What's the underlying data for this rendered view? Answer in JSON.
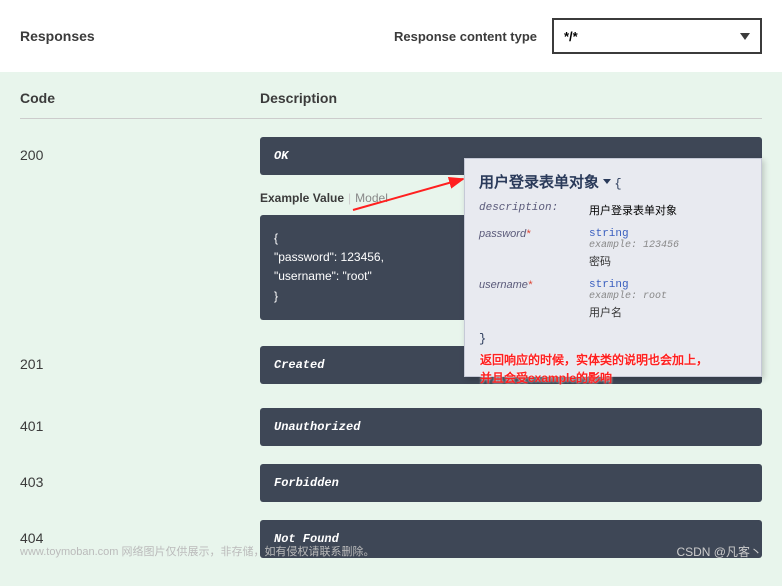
{
  "header": {
    "title": "Responses",
    "content_type_label": "Response content type",
    "content_type_value": "*/*"
  },
  "columns": {
    "code": "Code",
    "description": "Description"
  },
  "responses": [
    {
      "code": "200",
      "desc": "OK"
    },
    {
      "code": "201",
      "desc": "Created"
    },
    {
      "code": "401",
      "desc": "Unauthorized"
    },
    {
      "code": "403",
      "desc": "Forbidden"
    },
    {
      "code": "404",
      "desc": "Not Found"
    }
  ],
  "example_tabs": {
    "active": "Example Value",
    "inactive": "Model"
  },
  "example_code": {
    "l1": "{",
    "l2": "  \"password\": 123456,",
    "l3": "  \"username\": \"root\"",
    "l4": "}"
  },
  "tooltip": {
    "title": "用户登录表单对象",
    "description_key": "description:",
    "description_val": "用户登录表单对象",
    "fields": [
      {
        "name": "password",
        "required": "*",
        "type": "string",
        "example": "example: 123456",
        "desc": "密码"
      },
      {
        "name": "username",
        "required": "*",
        "type": "string",
        "example": "example: root",
        "desc": "用户名"
      }
    ],
    "brace_open": "{",
    "brace_close": "}"
  },
  "annotation": {
    "line1": "返回响应的时候，实体类的说明也会加上，",
    "line2": "并且会受example的影响"
  },
  "footer": {
    "left": "www.toymoban.com 网络图片仅供展示，非存储，如有侵权请联系删除。",
    "right": "CSDN @凡客丶"
  }
}
